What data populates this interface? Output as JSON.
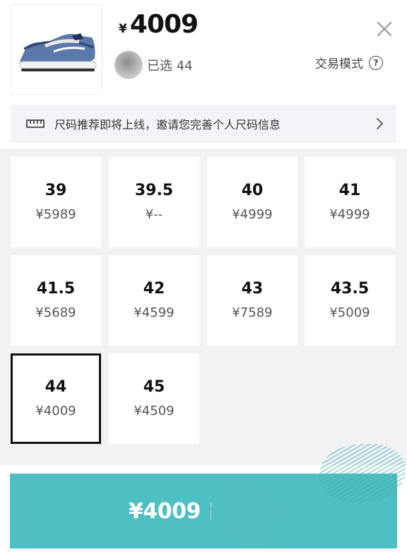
{
  "product": {
    "image_icon": "sneaker-image",
    "currency_symbol": "¥",
    "price": "4009",
    "selected_label": "已选 44"
  },
  "header": {
    "close_icon": "close-icon",
    "mode_label": "交易模式",
    "mode_help_glyph": "?"
  },
  "banner": {
    "icon": "ruler-icon",
    "text": "尺码推荐即将上线，邀请您完善个人尺码信息"
  },
  "sizes": [
    {
      "size": "39",
      "price": "¥5989"
    },
    {
      "size": "39.5",
      "price": "¥--"
    },
    {
      "size": "40",
      "price": "¥4999"
    },
    {
      "size": "41",
      "price": "¥4999"
    },
    {
      "size": "41.5",
      "price": "¥5689"
    },
    {
      "size": "42",
      "price": "¥4599"
    },
    {
      "size": "43",
      "price": "¥7589"
    },
    {
      "size": "43.5",
      "price": "¥5009"
    },
    {
      "size": "44",
      "price": "¥4009"
    },
    {
      "size": "45",
      "price": "¥4509"
    }
  ],
  "selected_size": "44",
  "buy_button": {
    "price": "¥4009"
  },
  "colors": {
    "accent": "#4ebfc2",
    "grid_bg": "#f2f2f4",
    "banner_bg": "#f4f4f8"
  }
}
